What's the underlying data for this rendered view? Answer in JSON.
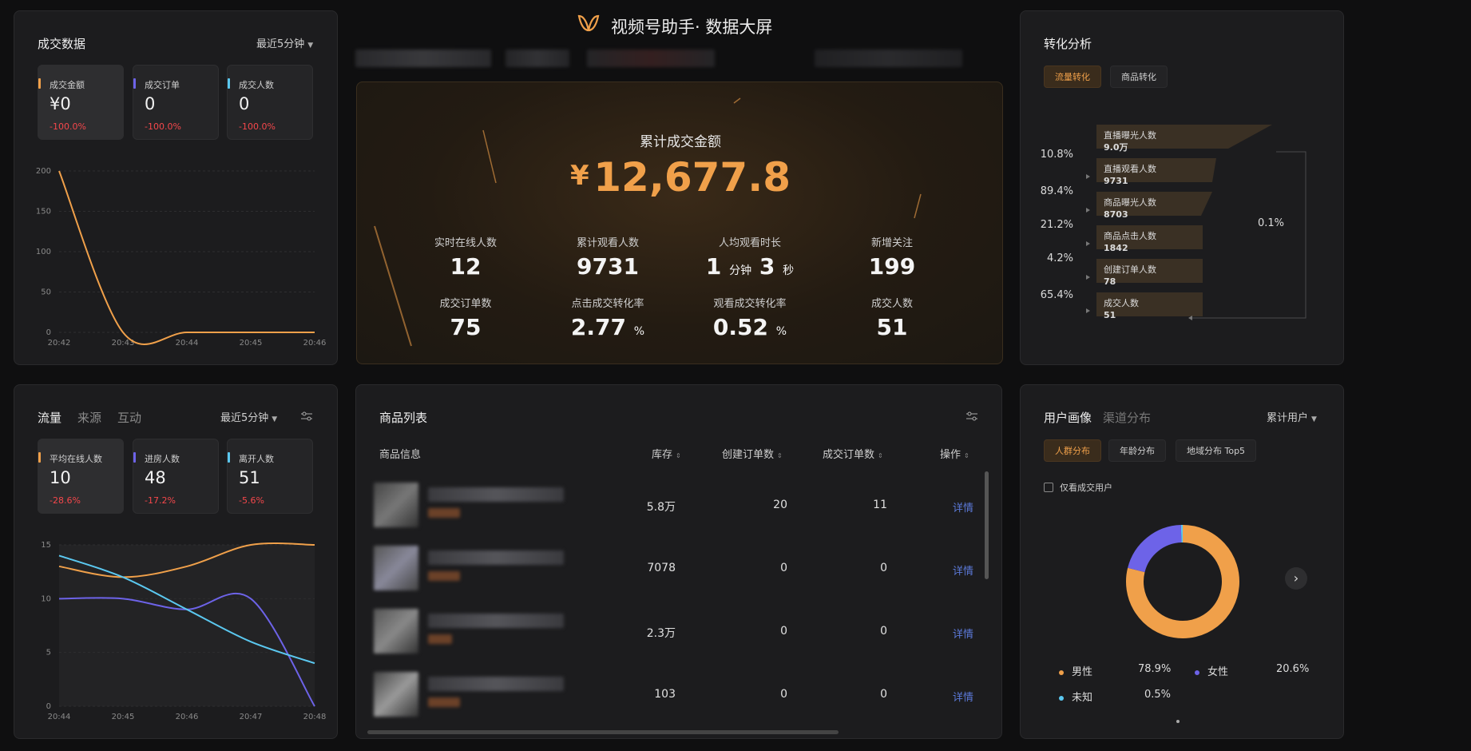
{
  "header": {
    "title": "视频号助手· 数据大屏"
  },
  "deal_panel": {
    "title": "成交数据",
    "range": "最近5分钟",
    "kpis": [
      {
        "label": "成交金额",
        "value": "¥0",
        "change": "-100.0%",
        "color": "#f0a04a"
      },
      {
        "label": "成交订单",
        "value": "0",
        "change": "-100.0%",
        "color": "#6d63e8"
      },
      {
        "label": "成交人数",
        "value": "0",
        "change": "-100.0%",
        "color": "#5bc8f0"
      }
    ]
  },
  "center": {
    "label": "累计成交金额",
    "amount": "12,677.8",
    "currency": "¥",
    "stats": [
      {
        "label": "实时在线人数",
        "value": "12"
      },
      {
        "label": "累计观看人数",
        "value": "9731"
      },
      {
        "label": "人均观看时长",
        "value_a": "1",
        "unit_a": "分钟",
        "value_b": "3",
        "unit_b": "秒"
      },
      {
        "label": "新增关注",
        "value": "199"
      },
      {
        "label": "成交订单数",
        "value": "75"
      },
      {
        "label": "点击成交转化率",
        "value": "2.77",
        "unit": "%"
      },
      {
        "label": "观看成交转化率",
        "value": "0.52",
        "unit": "%"
      },
      {
        "label": "成交人数",
        "value": "51"
      }
    ]
  },
  "conversion": {
    "title": "转化分析",
    "tabs": [
      "流量转化",
      "商品转化"
    ],
    "steps": [
      {
        "label": "直播曝光人数",
        "value": "9.0万"
      },
      {
        "label": "直播观看人数",
        "value": "9731"
      },
      {
        "label": "商品曝光人数",
        "value": "8703"
      },
      {
        "label": "商品点击人数",
        "value": "1842"
      },
      {
        "label": "创建订单人数",
        "value": "78"
      },
      {
        "label": "成交人数",
        "value": "51"
      }
    ],
    "rates": [
      "10.8%",
      "89.4%",
      "21.2%",
      "4.2%",
      "65.4%"
    ],
    "overall": "0.1%"
  },
  "traffic": {
    "tabs": [
      "流量",
      "来源",
      "互动"
    ],
    "range": "最近5分钟",
    "kpis": [
      {
        "label": "平均在线人数",
        "value": "10",
        "change": "-28.6%",
        "color": "#f0a04a"
      },
      {
        "label": "进房人数",
        "value": "48",
        "change": "-17.2%",
        "color": "#6d63e8"
      },
      {
        "label": "离开人数",
        "value": "51",
        "change": "-5.6%",
        "color": "#5bc8f0"
      }
    ]
  },
  "products": {
    "title": "商品列表",
    "headers": [
      "商品信息",
      "库存",
      "创建订单数",
      "成交订单数",
      "操作"
    ],
    "rows": [
      {
        "stock": "5.8万",
        "created": "20",
        "deals": "11",
        "action": "详情"
      },
      {
        "stock": "7078",
        "created": "0",
        "deals": "0",
        "action": "详情"
      },
      {
        "stock": "2.3万",
        "created": "0",
        "deals": "0",
        "action": "详情"
      },
      {
        "stock": "103",
        "created": "0",
        "deals": "0",
        "action": "详情"
      }
    ]
  },
  "portrait": {
    "tabs": [
      "用户画像",
      "渠道分布"
    ],
    "range": "累计用户",
    "pills": [
      "人群分布",
      "年龄分布",
      "地域分布 Top5"
    ],
    "checkbox": "仅看成交用户",
    "legend": [
      {
        "label": "男性",
        "pct": "78.9%",
        "color": "#f0a04a"
      },
      {
        "label": "女性",
        "pct": "20.6%",
        "color": "#6d63e8"
      },
      {
        "label": "未知",
        "pct": "0.5%",
        "color": "#5bc8f0"
      }
    ]
  },
  "chart_data": [
    {
      "type": "line",
      "title": "",
      "x": [
        "20:42",
        "20:43",
        "20:44",
        "20:45",
        "20:46"
      ],
      "ylim": [
        0,
        200
      ],
      "yticks": [
        "0",
        "50",
        "100",
        "150",
        "200"
      ],
      "series": [
        {
          "values": [
            200,
            0,
            0,
            0,
            0
          ],
          "color": "#f0a04a"
        }
      ]
    },
    {
      "type": "line",
      "title": "",
      "x": [
        "20:44",
        "20:45",
        "20:46",
        "20:47",
        "20:48"
      ],
      "ylim": [
        0,
        15
      ],
      "yticks": [
        "0",
        "5",
        "10",
        "15"
      ],
      "series": [
        {
          "values": [
            13,
            12,
            13,
            15,
            15
          ],
          "color": "#f0a04a"
        },
        {
          "values": [
            10,
            10,
            9,
            10,
            0
          ],
          "color": "#6d63e8"
        },
        {
          "values": [
            14,
            12,
            9,
            6,
            4
          ],
          "color": "#5bc8f0"
        }
      ]
    },
    {
      "type": "pie",
      "title": "",
      "categories": [
        "男性",
        "女性",
        "未知"
      ],
      "values": [
        78.9,
        20.6,
        0.5
      ],
      "colors": [
        "#f0a04a",
        "#6d63e8",
        "#5bc8f0"
      ]
    }
  ]
}
